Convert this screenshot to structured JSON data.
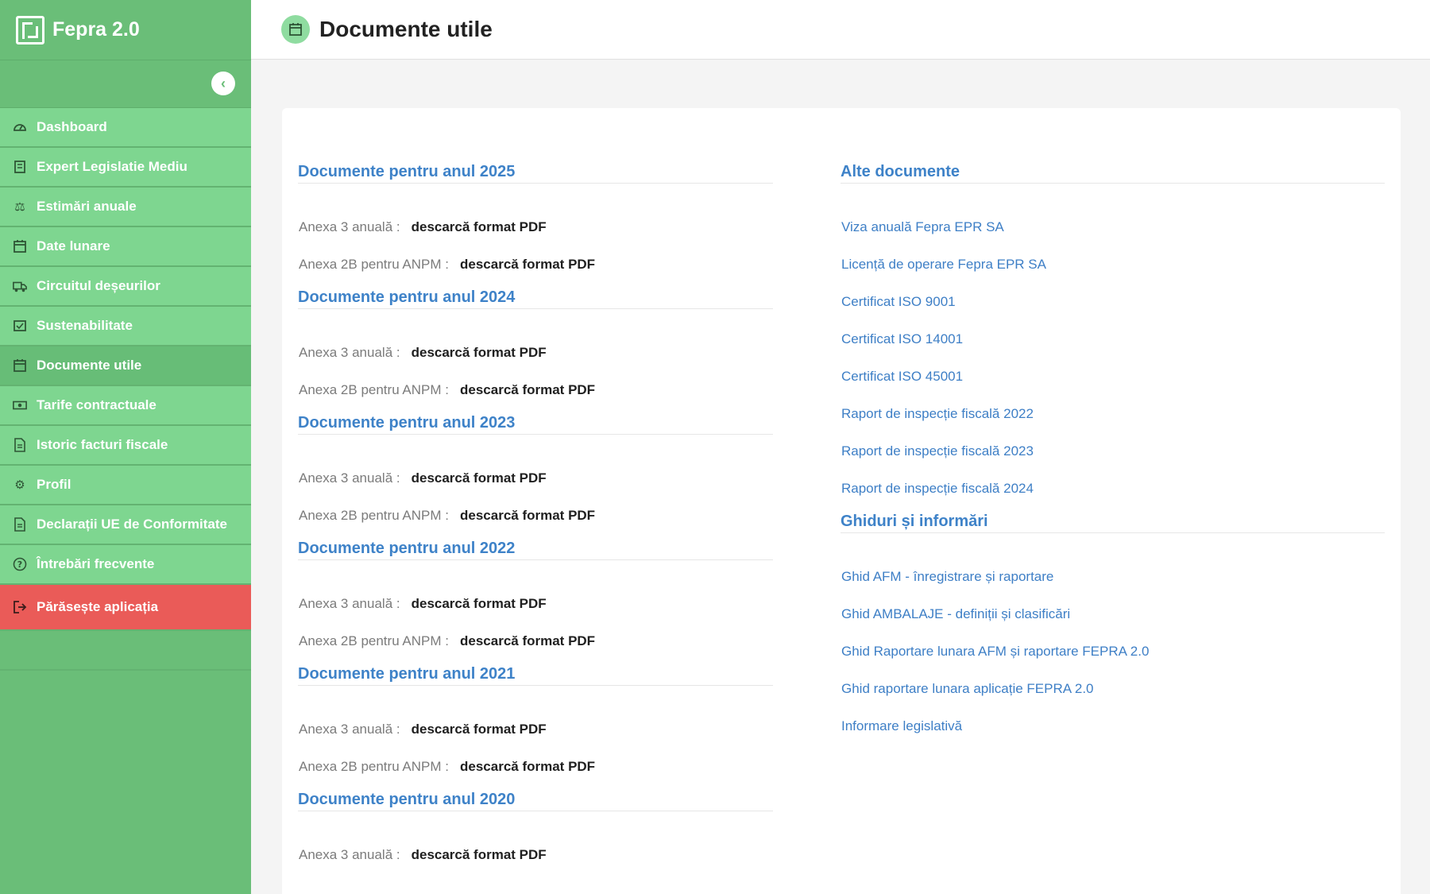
{
  "app": {
    "name": "Fepra 2.0"
  },
  "sidebar": {
    "collapse_icon": "chevron-left-icon",
    "items": [
      {
        "label": "Dashboard",
        "icon": "gauge-icon"
      },
      {
        "label": "Expert Legislatie Mediu",
        "icon": "book-icon"
      },
      {
        "label": "Estimări anuale",
        "icon": "scale-icon"
      },
      {
        "label": "Date lunare",
        "icon": "calendar-icon"
      },
      {
        "label": "Circuitul deșeurilor",
        "icon": "truck-icon"
      },
      {
        "label": "Sustenabilitate",
        "icon": "calendar-check-icon"
      },
      {
        "label": "Documente utile",
        "icon": "calendar-icon",
        "active": true
      },
      {
        "label": "Tarife contractuale",
        "icon": "money-icon"
      },
      {
        "label": "Istoric facturi fiscale",
        "icon": "file-icon"
      },
      {
        "label": "Profil",
        "icon": "gears-icon"
      },
      {
        "label": "Declarații UE de Conformitate",
        "icon": "file-icon"
      },
      {
        "label": "Întrebări frecvente",
        "icon": "question-icon"
      }
    ],
    "logout": {
      "label": "Părăsește aplicația",
      "icon": "logout-icon"
    }
  },
  "header": {
    "title": "Documente utile",
    "icon": "calendar-icon"
  },
  "left_column": {
    "sections": [
      {
        "title": "Documente pentru anul 2025",
        "rows": [
          {
            "label": "Anexa 3 anuală :",
            "link": "descarcă format PDF"
          },
          {
            "label": "Anexa 2B pentru ANPM :",
            "link": "descarcă format PDF"
          }
        ]
      },
      {
        "title": "Documente pentru anul 2024",
        "rows": [
          {
            "label": "Anexa 3 anuală :",
            "link": "descarcă format PDF"
          },
          {
            "label": "Anexa 2B pentru ANPM :",
            "link": "descarcă format PDF"
          }
        ]
      },
      {
        "title": "Documente pentru anul 2023",
        "rows": [
          {
            "label": "Anexa 3 anuală :",
            "link": "descarcă format PDF"
          },
          {
            "label": "Anexa 2B pentru ANPM :",
            "link": "descarcă format PDF"
          }
        ]
      },
      {
        "title": "Documente pentru anul 2022",
        "rows": [
          {
            "label": "Anexa 3 anuală :",
            "link": "descarcă format PDF"
          },
          {
            "label": "Anexa 2B pentru ANPM :",
            "link": "descarcă format PDF"
          }
        ]
      },
      {
        "title": "Documente pentru anul 2021",
        "rows": [
          {
            "label": "Anexa 3 anuală :",
            "link": "descarcă format PDF"
          },
          {
            "label": "Anexa 2B pentru ANPM :",
            "link": "descarcă format PDF"
          }
        ]
      },
      {
        "title": "Documente pentru anul 2020",
        "rows": [
          {
            "label": "Anexa 3 anuală :",
            "link": "descarcă format PDF"
          }
        ]
      }
    ]
  },
  "right_column": {
    "other_docs": {
      "title": "Alte documente",
      "links": [
        "Viza anuală Fepra EPR SA",
        "Licență de operare Fepra EPR SA",
        "Certificat ISO 9001",
        "Certificat ISO 14001",
        "Certificat ISO 45001",
        "Raport de inspecție fiscală 2022",
        "Raport de inspecție fiscală 2023",
        "Raport de inspecție fiscală 2024"
      ]
    },
    "guides": {
      "title": "Ghiduri și informări",
      "links": [
        "Ghid AFM - înregistrare și raportare",
        "Ghid AMBALAJE - definiții și clasificări",
        "Ghid Raportare lunara AFM și raportare FEPRA 2.0",
        "Ghid raportare lunara aplicație FEPRA 2.0",
        "Informare legislativă"
      ]
    }
  },
  "colors": {
    "sidebar": "#6abe78",
    "nav_item": "#7ed690",
    "logout": "#ea5b58",
    "link": "#3e82c8"
  }
}
